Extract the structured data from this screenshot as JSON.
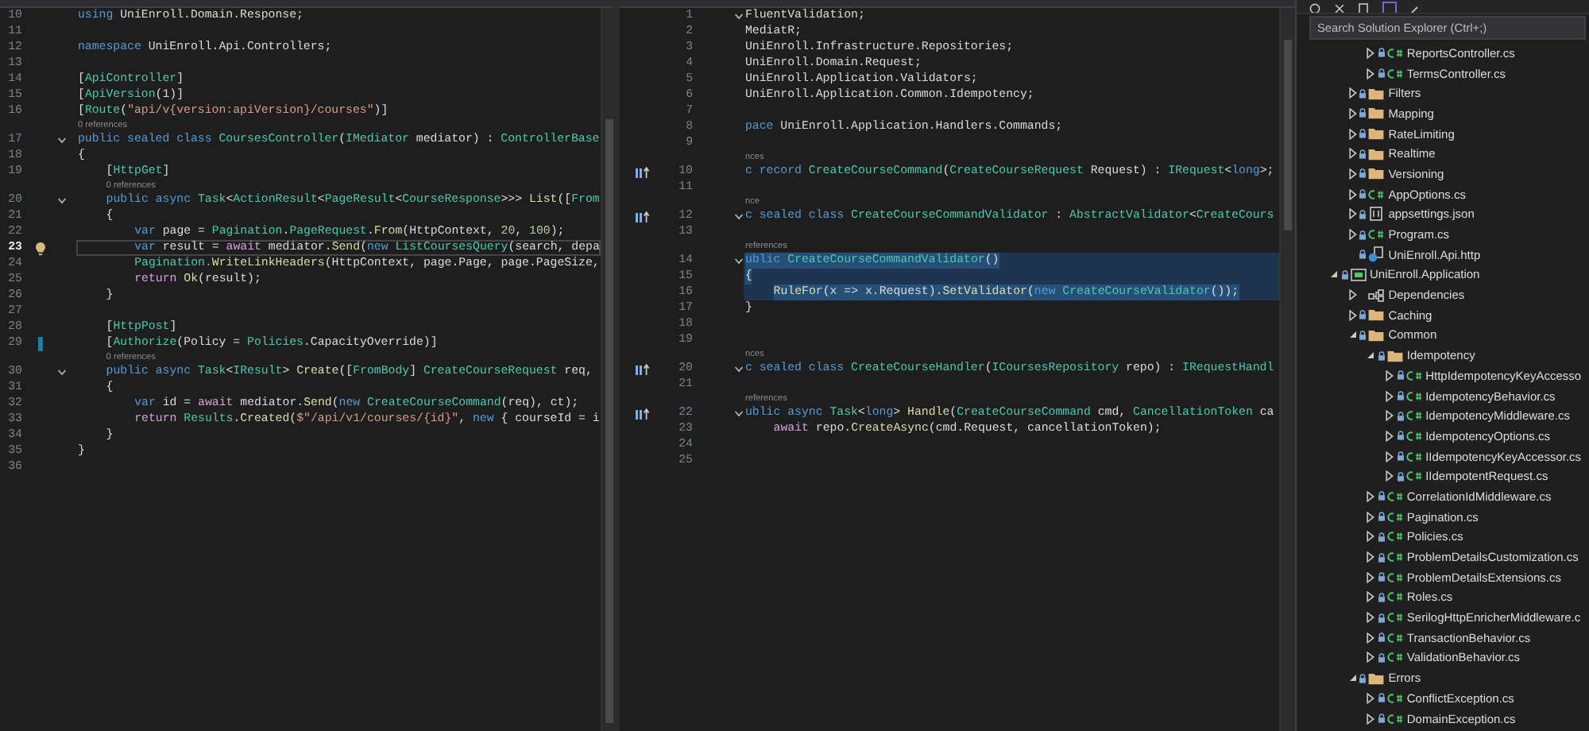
{
  "editors": [
    {
      "lines": [
        {
          "kind": "code",
          "number": "10",
          "foldable": false,
          "current": false,
          "tokens": [
            {
              "kind": "kw",
              "text": "using"
            },
            {
              "kind": "plain",
              "text": " UniEnroll.Domain.Response;"
            }
          ]
        },
        {
          "kind": "code",
          "number": "11",
          "foldable": false,
          "current": false
        },
        {
          "kind": "code",
          "number": "12",
          "foldable": false,
          "current": false,
          "tokens": [
            {
              "kind": "kw",
              "text": "namespace"
            },
            {
              "kind": "plain",
              "text": " UniEnroll.Api.Controllers;"
            }
          ]
        },
        {
          "kind": "code",
          "number": "13",
          "foldable": false,
          "current": false
        },
        {
          "kind": "code",
          "number": "14",
          "foldable": false,
          "current": false,
          "tokens": [
            {
              "kind": "plain",
              "text": "["
            },
            {
              "kind": "type",
              "text": "ApiController"
            },
            {
              "kind": "plain",
              "text": "]"
            }
          ]
        },
        {
          "kind": "code",
          "number": "15",
          "foldable": false,
          "current": false,
          "tokens": [
            {
              "kind": "plain",
              "text": "["
            },
            {
              "kind": "type",
              "text": "ApiVersion"
            },
            {
              "kind": "plain",
              "text": "(1)]"
            }
          ]
        },
        {
          "kind": "code",
          "number": "16",
          "foldable": false,
          "current": false,
          "tokens": [
            {
              "kind": "plain",
              "text": "["
            },
            {
              "kind": "type",
              "text": "Route"
            },
            {
              "kind": "plain",
              "text": "("
            },
            {
              "kind": "str",
              "text": "\"api/v{version:apiVersion}/courses\""
            },
            {
              "kind": "plain",
              "text": ")]"
            }
          ]
        },
        {
          "kind": "lens",
          "text": "0 references"
        },
        {
          "kind": "code",
          "number": "17",
          "foldable": true,
          "current": false,
          "tokens": [
            {
              "kind": "kw",
              "text": "public sealed class "
            },
            {
              "kind": "type",
              "text": "CoursesController"
            },
            {
              "kind": "plain",
              "text": "("
            },
            {
              "kind": "type",
              "text": "IMediator"
            },
            {
              "kind": "plain",
              "text": " mediator) : "
            },
            {
              "kind": "type",
              "text": "ControllerBase"
            }
          ]
        },
        {
          "kind": "code",
          "number": "18",
          "foldable": false,
          "current": false,
          "tokens": [
            {
              "kind": "plain",
              "text": "{"
            }
          ],
          "children": [
            {
              "kind": "code",
              "number": "19",
              "foldable": false,
              "current": false,
              "tokens": [
                {
                  "kind": "plain",
                  "text": "["
                },
                {
                  "kind": "type",
                  "text": "HttpGet"
                },
                {
                  "kind": "plain",
                  "text": "]"
                }
              ]
            },
            {
              "kind": "lens",
              "text": "0 references"
            },
            {
              "kind": "code",
              "number": "20",
              "foldable": true,
              "current": false,
              "tokens": [
                {
                  "kind": "kw",
                  "text": "public async "
                },
                {
                  "kind": "type",
                  "text": "Task"
                },
                {
                  "kind": "plain",
                  "text": "<"
                },
                {
                  "kind": "type",
                  "text": "ActionResult"
                },
                {
                  "kind": "plain",
                  "text": "<"
                },
                {
                  "kind": "type",
                  "text": "PageResult"
                },
                {
                  "kind": "plain",
                  "text": "<"
                },
                {
                  "kind": "type",
                  "text": "CourseResponse"
                },
                {
                  "kind": "plain",
                  "text": ">>> "
                },
                {
                  "kind": "method",
                  "text": "List"
                },
                {
                  "kind": "plain",
                  "text": "(["
                },
                {
                  "kind": "type",
                  "text": "From"
                }
              ]
            },
            {
              "kind": "code",
              "number": "21",
              "foldable": false,
              "current": false,
              "tokens": [
                {
                  "kind": "plain",
                  "text": "{"
                }
              ],
              "children": [
                {
                  "kind": "code",
                  "number": "22",
                  "foldable": false,
                  "current": false,
                  "tokens": [
                    {
                      "kind": "kw",
                      "text": "var"
                    },
                    {
                      "kind": "plain",
                      "text": " page = "
                    },
                    {
                      "kind": "type",
                      "text": "Pagination"
                    },
                    {
                      "kind": "plain",
                      "text": "."
                    },
                    {
                      "kind": "type",
                      "text": "PageRequest"
                    },
                    {
                      "kind": "plain",
                      "text": "."
                    },
                    {
                      "kind": "method",
                      "text": "From"
                    },
                    {
                      "kind": "plain",
                      "text": "(HttpContext, "
                    },
                    {
                      "kind": "num",
                      "text": "20"
                    },
                    {
                      "kind": "plain",
                      "text": ", "
                    },
                    {
                      "kind": "num",
                      "text": "100"
                    },
                    {
                      "kind": "plain",
                      "text": ");"
                    }
                  ]
                },
                {
                  "kind": "code",
                  "number": "23",
                  "foldable": false,
                  "current": true,
                  "marker": {
                    "kind": "lightbulb"
                  },
                  "tokens": [
                    {
                      "kind": "kw",
                      "text": "var"
                    },
                    {
                      "kind": "plain",
                      "text": " result = "
                    },
                    {
                      "kind": "ctl",
                      "text": "await"
                    },
                    {
                      "kind": "plain",
                      "text": " mediator."
                    },
                    {
                      "kind": "method",
                      "text": "Send"
                    },
                    {
                      "kind": "plain",
                      "text": "("
                    },
                    {
                      "kind": "kw",
                      "text": "new "
                    },
                    {
                      "kind": "type",
                      "text": "ListCoursesQuery"
                    },
                    {
                      "kind": "plain",
                      "text": "(search, depa"
                    }
                  ]
                },
                {
                  "kind": "code",
                  "number": "24",
                  "foldable": false,
                  "current": false,
                  "tokens": [
                    {
                      "kind": "type",
                      "text": "Pagination."
                    },
                    {
                      "kind": "method",
                      "text": "WriteLinkHeaders"
                    },
                    {
                      "kind": "plain",
                      "text": "(HttpContext, page.Page, page.PageSize,"
                    }
                  ]
                },
                {
                  "kind": "code",
                  "number": "25",
                  "foldable": false,
                  "current": false,
                  "tokens": [
                    {
                      "kind": "ctl",
                      "text": "return "
                    },
                    {
                      "kind": "method",
                      "text": "Ok"
                    },
                    {
                      "kind": "plain",
                      "text": "(result);"
                    }
                  ]
                }
              ]
            },
            {
              "kind": "code",
              "number": "26",
              "foldable": false,
              "current": false,
              "tokens": [
                {
                  "kind": "plain",
                  "text": "}"
                }
              ]
            },
            {
              "kind": "code",
              "number": "27",
              "foldable": false,
              "current": false
            },
            {
              "kind": "code",
              "number": "28",
              "foldable": false,
              "current": false,
              "tokens": [
                {
                  "kind": "plain",
                  "text": "["
                },
                {
                  "kind": "type",
                  "text": "HttpPost"
                },
                {
                  "kind": "plain",
                  "text": "]"
                }
              ]
            },
            {
              "kind": "code",
              "number": "29",
              "foldable": false,
              "current": false,
              "marker": {
                "kind": "change"
              },
              "tokens": [
                {
                  "kind": "plain",
                  "text": "["
                },
                {
                  "kind": "type",
                  "text": "Authorize"
                },
                {
                  "kind": "plain",
                  "text": "(Policy = "
                },
                {
                  "kind": "type",
                  "text": "Policies"
                },
                {
                  "kind": "plain",
                  "text": ".CapacityOverride)]"
                }
              ]
            },
            {
              "kind": "lens",
              "text": "0 references"
            },
            {
              "kind": "code",
              "number": "30",
              "foldable": true,
              "current": false,
              "tokens": [
                {
                  "kind": "kw",
                  "text": "public async "
                },
                {
                  "kind": "type",
                  "text": "Task"
                },
                {
                  "kind": "plain",
                  "text": "<"
                },
                {
                  "kind": "type",
                  "text": "IResult"
                },
                {
                  "kind": "plain",
                  "text": "> "
                },
                {
                  "kind": "method",
                  "text": "Create"
                },
                {
                  "kind": "plain",
                  "text": "(["
                },
                {
                  "kind": "type",
                  "text": "FromBody"
                },
                {
                  "kind": "plain",
                  "text": "] "
                },
                {
                  "kind": "type",
                  "text": "CreateCourseRequest"
                },
                {
                  "kind": "plain",
                  "text": " req,"
                }
              ]
            },
            {
              "kind": "code",
              "number": "31",
              "foldable": false,
              "current": false,
              "tokens": [
                {
                  "kind": "plain",
                  "text": "{"
                }
              ],
              "children": [
                {
                  "kind": "code",
                  "number": "32",
                  "foldable": false,
                  "current": false,
                  "tokens": [
                    {
                      "kind": "kw",
                      "text": "var"
                    },
                    {
                      "kind": "plain",
                      "text": " id = "
                    },
                    {
                      "kind": "ctl",
                      "text": "await"
                    },
                    {
                      "kind": "plain",
                      "text": " mediator."
                    },
                    {
                      "kind": "method",
                      "text": "Send"
                    },
                    {
                      "kind": "plain",
                      "text": "("
                    },
                    {
                      "kind": "kw",
                      "text": "new "
                    },
                    {
                      "kind": "type",
                      "text": "CreateCourseCommand"
                    },
                    {
                      "kind": "plain",
                      "text": "(req), ct);"
                    }
                  ]
                },
                {
                  "kind": "code",
                  "number": "33",
                  "foldable": false,
                  "current": false,
                  "tokens": [
                    {
                      "kind": "ctl",
                      "text": "return "
                    },
                    {
                      "kind": "type",
                      "text": "Results"
                    },
                    {
                      "kind": "plain",
                      "text": "."
                    },
                    {
                      "kind": "method",
                      "text": "Created"
                    },
                    {
                      "kind": "plain",
                      "text": "("
                    },
                    {
                      "kind": "str",
                      "text": "$\"/api/v1/courses/{id}\""
                    },
                    {
                      "kind": "plain",
                      "text": ", "
                    },
                    {
                      "kind": "kw",
                      "text": "new"
                    },
                    {
                      "kind": "plain",
                      "text": " { courseId = i"
                    }
                  ]
                }
              ]
            },
            {
              "kind": "code",
              "number": "34",
              "foldable": false,
              "current": false,
              "tokens": [
                {
                  "kind": "plain",
                  "text": "}"
                }
              ]
            }
          ]
        },
        {
          "kind": "code",
          "number": "35",
          "foldable": false,
          "current": false,
          "tokens": [
            {
              "kind": "plain",
              "text": "}"
            }
          ]
        },
        {
          "kind": "code",
          "number": "36",
          "foldable": false,
          "current": false
        }
      ]
    },
    {
      "lines": [
        {
          "kind": "code",
          "number": "1",
          "foldable": true,
          "selected": false,
          "tokens": [
            {
              "kind": "plain",
              "text": "FluentValidation;"
            }
          ]
        },
        {
          "kind": "code",
          "number": "2",
          "foldable": false,
          "selected": false,
          "tokens": [
            {
              "kind": "plain",
              "text": "MediatR;"
            }
          ]
        },
        {
          "kind": "code",
          "number": "3",
          "foldable": false,
          "selected": false,
          "tokens": [
            {
              "kind": "plain",
              "text": "UniEnroll.Infrastructure.Repositories;"
            }
          ]
        },
        {
          "kind": "code",
          "number": "4",
          "foldable": false,
          "selected": false,
          "tokens": [
            {
              "kind": "plain",
              "text": "UniEnroll.Domain.Request;"
            }
          ]
        },
        {
          "kind": "code",
          "number": "5",
          "foldable": false,
          "selected": false,
          "tokens": [
            {
              "kind": "plain",
              "text": "UniEnroll.Application.Validators;"
            }
          ]
        },
        {
          "kind": "code",
          "number": "6",
          "foldable": false,
          "selected": false,
          "tokens": [
            {
              "kind": "plain",
              "text": "UniEnroll.Application.Common.Idempotency;"
            }
          ]
        },
        {
          "kind": "code",
          "number": "7",
          "foldable": false,
          "selected": false
        },
        {
          "kind": "code",
          "number": "8",
          "foldable": false,
          "selected": false,
          "tokens": [
            {
              "kind": "kw",
              "text": "pace"
            },
            {
              "kind": "plain",
              "text": " UniEnroll.Application.Handlers.Commands;"
            }
          ]
        },
        {
          "kind": "code",
          "number": "9",
          "foldable": false,
          "selected": false
        },
        {
          "kind": "lens",
          "text": "nces"
        },
        {
          "kind": "code",
          "number": "10",
          "foldable": false,
          "selected": false,
          "marker": {
            "kind": "inherit"
          },
          "tokens": [
            {
              "kind": "kw",
              "text": "c record "
            },
            {
              "kind": "type",
              "text": "CreateCourseCommand"
            },
            {
              "kind": "plain",
              "text": "("
            },
            {
              "kind": "type",
              "text": "CreateCourseRequest"
            },
            {
              "kind": "plain",
              "text": " Request) : "
            },
            {
              "kind": "type",
              "text": "IRequest"
            },
            {
              "kind": "plain",
              "text": "<"
            },
            {
              "kind": "kw",
              "text": "long"
            },
            {
              "kind": "plain",
              "text": ">;"
            }
          ]
        },
        {
          "kind": "code",
          "number": "11",
          "foldable": false,
          "selected": false
        },
        {
          "kind": "lens",
          "text": "nce"
        },
        {
          "kind": "code",
          "number": "12",
          "foldable": true,
          "selected": false,
          "marker": {
            "kind": "inherit"
          },
          "tokens": [
            {
              "kind": "kw",
              "text": "c sealed class "
            },
            {
              "kind": "type",
              "text": "CreateCourseCommandValidator"
            },
            {
              "kind": "plain",
              "text": " : "
            },
            {
              "kind": "type",
              "text": "AbstractValidator"
            },
            {
              "kind": "plain",
              "text": "<"
            },
            {
              "kind": "type",
              "text": "CreateCours"
            }
          ]
        },
        {
          "kind": "code",
          "number": "13",
          "foldable": false,
          "selected": false
        },
        {
          "kind": "lens",
          "text": "references"
        },
        {
          "kind": "code",
          "number": "14",
          "foldable": true,
          "selected": true,
          "tokens": [
            {
              "kind": "kw",
              "text": "ublic "
            },
            {
              "kind": "type",
              "text": "CreateCourseCommandValidator"
            },
            {
              "kind": "plain",
              "text": "()"
            }
          ]
        },
        {
          "kind": "code",
          "number": "15",
          "foldable": false,
          "selected": true,
          "tokens": [
            {
              "kind": "plain",
              "text": "{"
            }
          ],
          "children": [
            {
              "kind": "code",
              "number": "16",
              "foldable": false,
              "selected": true,
              "tokens": [
                {
                  "kind": "method",
                  "text": "RuleFor"
                },
                {
                  "kind": "plain",
                  "text": "(x => x.Request)."
                },
                {
                  "kind": "method",
                  "text": "SetValidator"
                },
                {
                  "kind": "plain",
                  "text": "("
                },
                {
                  "kind": "kw",
                  "text": "new "
                },
                {
                  "kind": "type",
                  "text": "CreateCourseValidator"
                },
                {
                  "kind": "plain",
                  "text": "());"
                }
              ]
            }
          ]
        },
        {
          "kind": "code",
          "number": "17",
          "foldable": false,
          "selected": false,
          "tokens": [
            {
              "kind": "plain",
              "text": "}"
            }
          ]
        },
        {
          "kind": "code",
          "number": "18",
          "foldable": false,
          "selected": false
        },
        {
          "kind": "code",
          "number": "19",
          "foldable": false,
          "selected": false
        },
        {
          "kind": "lens",
          "text": "nces"
        },
        {
          "kind": "code",
          "number": "20",
          "foldable": true,
          "selected": false,
          "marker": {
            "kind": "inherit"
          },
          "tokens": [
            {
              "kind": "kw",
              "text": "c sealed class "
            },
            {
              "kind": "type",
              "text": "CreateCourseHandler"
            },
            {
              "kind": "plain",
              "text": "("
            },
            {
              "kind": "type",
              "text": "ICoursesRepository"
            },
            {
              "kind": "plain",
              "text": " repo) : "
            },
            {
              "kind": "type",
              "text": "IRequestHandl"
            }
          ]
        },
        {
          "kind": "code",
          "number": "21",
          "foldable": false,
          "selected": false
        },
        {
          "kind": "lens",
          "text": "references"
        },
        {
          "kind": "code",
          "number": "22",
          "foldable": true,
          "selected": false,
          "marker": {
            "kind": "inherit"
          },
          "tokens": [
            {
              "kind": "kw",
              "text": "ublic async "
            },
            {
              "kind": "type",
              "text": "Task"
            },
            {
              "kind": "plain",
              "text": "<"
            },
            {
              "kind": "kw",
              "text": "long"
            },
            {
              "kind": "plain",
              "text": "> "
            },
            {
              "kind": "method",
              "text": "Handle"
            },
            {
              "kind": "plain",
              "text": "("
            },
            {
              "kind": "type",
              "text": "CreateCourseCommand"
            },
            {
              "kind": "plain",
              "text": " cmd, "
            },
            {
              "kind": "type",
              "text": "CancellationToken"
            },
            {
              "kind": "plain",
              "text": " ca"
            }
          ],
          "children": [
            {
              "kind": "code",
              "number": "23",
              "foldable": false,
              "selected": false,
              "tokens": [
                {
                  "kind": "ctl",
                  "text": "await"
                },
                {
                  "kind": "plain",
                  "text": " repo."
                },
                {
                  "kind": "method",
                  "text": "CreateAsync"
                },
                {
                  "kind": "plain",
                  "text": "(cmd.Request, cancellationToken);"
                }
              ]
            }
          ]
        },
        {
          "kind": "code",
          "number": "24",
          "foldable": false,
          "selected": false
        },
        {
          "kind": "code",
          "number": "25",
          "foldable": false,
          "selected": false
        }
      ]
    }
  ],
  "solution_explorer": {
    "search": {
      "placeholder": "Search Solution Explorer (Ctrl+;)"
    },
    "tree": [
      {
        "children": [
          {
            "children": [
              {
                "kind": "cs",
                "label": "ReportsController.cs",
                "expanded": false
              },
              {
                "kind": "cs",
                "label": "TermsController.cs",
                "expanded": false
              }
            ]
          },
          {
            "kind": "folder",
            "label": "Filters",
            "expanded": false
          },
          {
            "kind": "folder",
            "label": "Mapping",
            "expanded": false
          },
          {
            "kind": "folder",
            "label": "RateLimiting",
            "expanded": false
          },
          {
            "kind": "folder",
            "label": "Realtime",
            "expanded": false
          },
          {
            "kind": "folder",
            "label": "Versioning",
            "expanded": false
          },
          {
            "kind": "cs",
            "label": "AppOptions.cs",
            "expanded": false
          },
          {
            "kind": "json",
            "label": "appsettings.json",
            "expanded": false
          },
          {
            "kind": "cs",
            "label": "Program.cs",
            "expanded": false
          },
          {
            "kind": "http",
            "label": "UniEnroll.Api.http"
          }
        ]
      },
      {
        "kind": "project",
        "label": "UniEnroll.Application",
        "expanded": true,
        "children": [
          {
            "kind": "deps",
            "label": "Dependencies",
            "expanded": false
          },
          {
            "kind": "folder",
            "label": "Caching",
            "expanded": false
          },
          {
            "kind": "folder",
            "label": "Common",
            "expanded": true,
            "children": [
              {
                "kind": "folder",
                "label": "Idempotency",
                "expanded": true,
                "children": [
                  {
                    "kind": "cs",
                    "label": "HttpIdempotencyKeyAccesso",
                    "expanded": false
                  },
                  {
                    "kind": "cs",
                    "label": "IdempotencyBehavior.cs",
                    "expanded": false
                  },
                  {
                    "kind": "cs",
                    "label": "IdempotencyMiddleware.cs",
                    "expanded": false
                  },
                  {
                    "kind": "cs",
                    "label": "IdempotencyOptions.cs",
                    "expanded": false
                  },
                  {
                    "kind": "cs",
                    "label": "IIdempotencyKeyAccessor.cs",
                    "expanded": false
                  },
                  {
                    "kind": "cs",
                    "label": "IIdempotentRequest.cs",
                    "expanded": false
                  }
                ]
              },
              {
                "kind": "cs",
                "label": "CorrelationIdMiddleware.cs",
                "expanded": false
              },
              {
                "kind": "cs",
                "label": "Pagination.cs",
                "expanded": false
              },
              {
                "kind": "cs",
                "label": "Policies.cs",
                "expanded": false
              },
              {
                "kind": "cs",
                "label": "ProblemDetailsCustomization.cs",
                "expanded": false
              },
              {
                "kind": "cs",
                "label": "ProblemDetailsExtensions.cs",
                "expanded": false
              },
              {
                "kind": "cs",
                "label": "Roles.cs",
                "expanded": false
              },
              {
                "kind": "cs",
                "label": "SerilogHttpEnricherMiddleware.c",
                "expanded": false
              },
              {
                "kind": "cs",
                "label": "TransactionBehavior.cs",
                "expanded": false
              },
              {
                "kind": "cs",
                "label": "ValidationBehavior.cs",
                "expanded": false
              }
            ]
          },
          {
            "kind": "folder",
            "label": "Errors",
            "expanded": true,
            "children": [
              {
                "kind": "cs",
                "label": "ConflictException.cs",
                "expanded": false
              },
              {
                "kind": "cs",
                "label": "DomainException.cs",
                "expanded": false
              }
            ]
          }
        ]
      }
    ]
  }
}
